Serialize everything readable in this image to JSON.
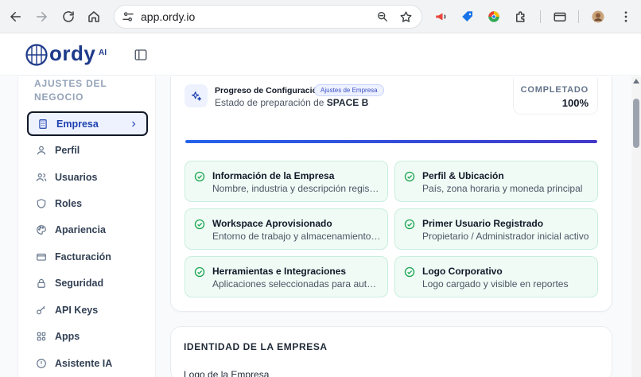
{
  "browser": {
    "url": "app.ordy.io",
    "icons": [
      "back-icon",
      "forward-icon",
      "reload-icon",
      "home-icon",
      "site-settings-icon",
      "zoom-icon",
      "bookmark-star-icon",
      "megaphone-extension-icon",
      "tag-extension-icon",
      "chrome-extension-icon",
      "puzzle-extensions-icon",
      "payment-card-icon",
      "profile-avatar-icon",
      "menu-kebab-icon"
    ]
  },
  "header": {
    "logo_text": "ordy",
    "logo_suffix": "AI"
  },
  "sidebar": {
    "heading": "AJUSTES DEL NEGOCIO",
    "items": [
      {
        "label": "Empresa",
        "icon": "building-icon",
        "active": true
      },
      {
        "label": "Perfil",
        "icon": "user-icon"
      },
      {
        "label": "Usuarios",
        "icon": "users-icon"
      },
      {
        "label": "Roles",
        "icon": "shield-icon"
      },
      {
        "label": "Apariencia",
        "icon": "palette-icon"
      },
      {
        "label": "Facturación",
        "icon": "credit-card-icon"
      },
      {
        "label": "Seguridad",
        "icon": "lock-icon"
      },
      {
        "label": "API Keys",
        "icon": "key-icon"
      },
      {
        "label": "Apps",
        "icon": "apps-icon"
      },
      {
        "label": "Asistente IA",
        "icon": "assistant-icon"
      }
    ]
  },
  "progress": {
    "title": "Progreso de Configuración",
    "badge": "Ajustes de Empresa",
    "subtitle_prefix": "Estado de preparación de",
    "subtitle_name": "SPACE B",
    "status_label": "COMPLETADO",
    "status_value": "100%",
    "fraction": 1.0
  },
  "steps": [
    {
      "title": "Información de la Empresa",
      "desc": "Nombre, industria y descripción registrada"
    },
    {
      "title": "Perfil & Ubicación",
      "desc": "País, zona horaria y moneda principal"
    },
    {
      "title": "Workspace Aprovisionado",
      "desc": "Entorno de trabajo y almacenamiento listo"
    },
    {
      "title": "Primer Usuario Registrado",
      "desc": "Propietario / Administrador inicial activo"
    },
    {
      "title": "Herramientas e Integraciones",
      "desc": "Aplicaciones seleccionadas para automatizar"
    },
    {
      "title": "Logo Corporativo",
      "desc": "Logo cargado y visible en reportes"
    }
  ],
  "identity": {
    "title": "IDENTIDAD DE LA EMPRESA",
    "logo_label": "Logo de la Empresa"
  },
  "colors": {
    "brand": "#1e3a8a",
    "accent": "#2563eb",
    "success": "#16a34a"
  }
}
